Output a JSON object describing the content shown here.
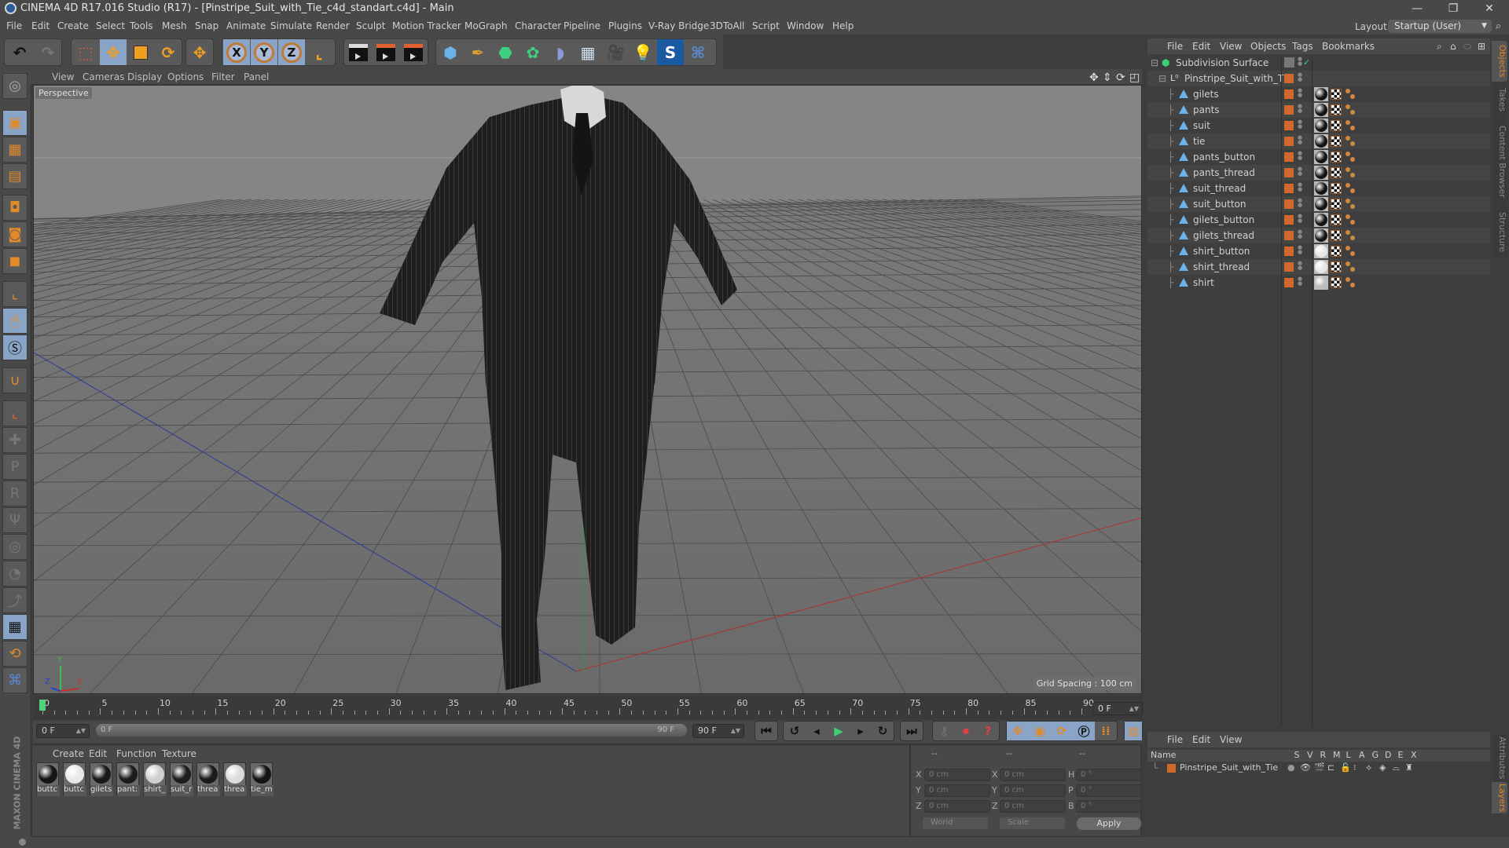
{
  "window": {
    "title": "CINEMA 4D R17.016 Studio (R17) - [Pinstripe_Suit_with_Tie_c4d_standart.c4d] - Main",
    "controls": [
      "minimize",
      "restore",
      "close"
    ]
  },
  "menu": [
    "File",
    "Edit",
    "Create",
    "Select",
    "Tools",
    "Mesh",
    "Snap",
    "Animate",
    "Simulate",
    "Render",
    "Sculpt",
    "Motion Tracker",
    "MoGraph",
    "Character",
    "Pipeline",
    "Plugins",
    "V-Ray Bridge",
    "3DToAll",
    "Script",
    "Window",
    "Help"
  ],
  "layout": {
    "label": "Layout:",
    "value": "Startup (User)"
  },
  "toolbar": {
    "axis_labels": [
      "X",
      "Y",
      "Z"
    ]
  },
  "viewport": {
    "menu": [
      "View",
      "Cameras",
      "Display",
      "Options",
      "Filter",
      "Panel"
    ],
    "camera_label": "Perspective",
    "grid_spacing": "Grid Spacing : 100 cm",
    "axis_gizmo": [
      "Y",
      "Z",
      "X"
    ]
  },
  "timeline": {
    "ticks": [
      0,
      5,
      10,
      15,
      20,
      25,
      30,
      35,
      40,
      45,
      50,
      55,
      60,
      65,
      70,
      75,
      80,
      85,
      90
    ],
    "current_frame": "0 F",
    "start_field": "0 F",
    "range_start": "0 F",
    "range_end": "90 F",
    "end_field": "90 F",
    "current_field": "0 F"
  },
  "material_manager": {
    "menu": [
      "Create",
      "Edit",
      "Function",
      "Texture"
    ],
    "materials": [
      {
        "label": "buttc",
        "color": "#151515"
      },
      {
        "label": "buttc",
        "color": "#e8e8e8"
      },
      {
        "label": "gilets",
        "color": "#1a1a1a"
      },
      {
        "label": "pant:",
        "color": "#1c1c1c"
      },
      {
        "label": "shirt_",
        "color": "#cfcfcf"
      },
      {
        "label": "suit_r",
        "color": "#1e1e1e"
      },
      {
        "label": "threa",
        "color": "#1b1b1b"
      },
      {
        "label": "threa",
        "color": "#dcdcdc"
      },
      {
        "label": "tie_m",
        "color": "#141414"
      }
    ],
    "brand_text": "MAXON CINEMA 4D"
  },
  "coordinates": {
    "headers": [
      "--",
      "--",
      "--"
    ],
    "rows": [
      {
        "a": "X",
        "a_val": "0 cm",
        "b": "X",
        "b_val": "0 cm",
        "c": "H",
        "c_val": "0 °"
      },
      {
        "a": "Y",
        "a_val": "0 cm",
        "b": "Y",
        "b_val": "0 cm",
        "c": "P",
        "c_val": "0 °"
      },
      {
        "a": "Z",
        "a_val": "0 cm",
        "b": "Z",
        "b_val": "0 cm",
        "c": "B",
        "c_val": "0 °"
      }
    ],
    "space": "World",
    "mode": "Scale",
    "apply": "Apply"
  },
  "object_manager": {
    "menu": [
      "File",
      "Edit",
      "View",
      "Objects",
      "Tags",
      "Bookmarks"
    ],
    "root": "Subdivision Surface",
    "group": "Pinstripe_Suit_with_Tie",
    "objects": [
      {
        "name": "gilets",
        "mat": "#151515"
      },
      {
        "name": "pants",
        "mat": "#151515"
      },
      {
        "name": "suit",
        "mat": "#151515"
      },
      {
        "name": "tie",
        "mat": "#151515"
      },
      {
        "name": "pants_button",
        "mat": "#151515"
      },
      {
        "name": "pants_thread",
        "mat": "#151515"
      },
      {
        "name": "suit_thread",
        "mat": "#151515"
      },
      {
        "name": "suit_button",
        "mat": "#151515"
      },
      {
        "name": "gilets_button",
        "mat": "#151515"
      },
      {
        "name": "gilets_thread",
        "mat": "#151515"
      },
      {
        "name": "shirt_button",
        "mat": "#e6e6e6"
      },
      {
        "name": "shirt_thread",
        "mat": "#e6e6e6"
      },
      {
        "name": "shirt",
        "mat": "#bdbdbd"
      }
    ],
    "accent_color": "#d0682c"
  },
  "layer_manager": {
    "menu": [
      "File",
      "Edit",
      "View"
    ],
    "columns": [
      "Name",
      "S",
      "V",
      "R",
      "M",
      "L",
      "A",
      "G",
      "D",
      "E",
      "X"
    ],
    "layers": [
      {
        "name": "Pinstripe_Suit_with_Tie"
      }
    ]
  },
  "side_tabs": {
    "top": [
      "Objects",
      "Takes",
      "Content Browser",
      "Structure"
    ],
    "bottom": [
      "Attributes",
      "Layers"
    ]
  }
}
